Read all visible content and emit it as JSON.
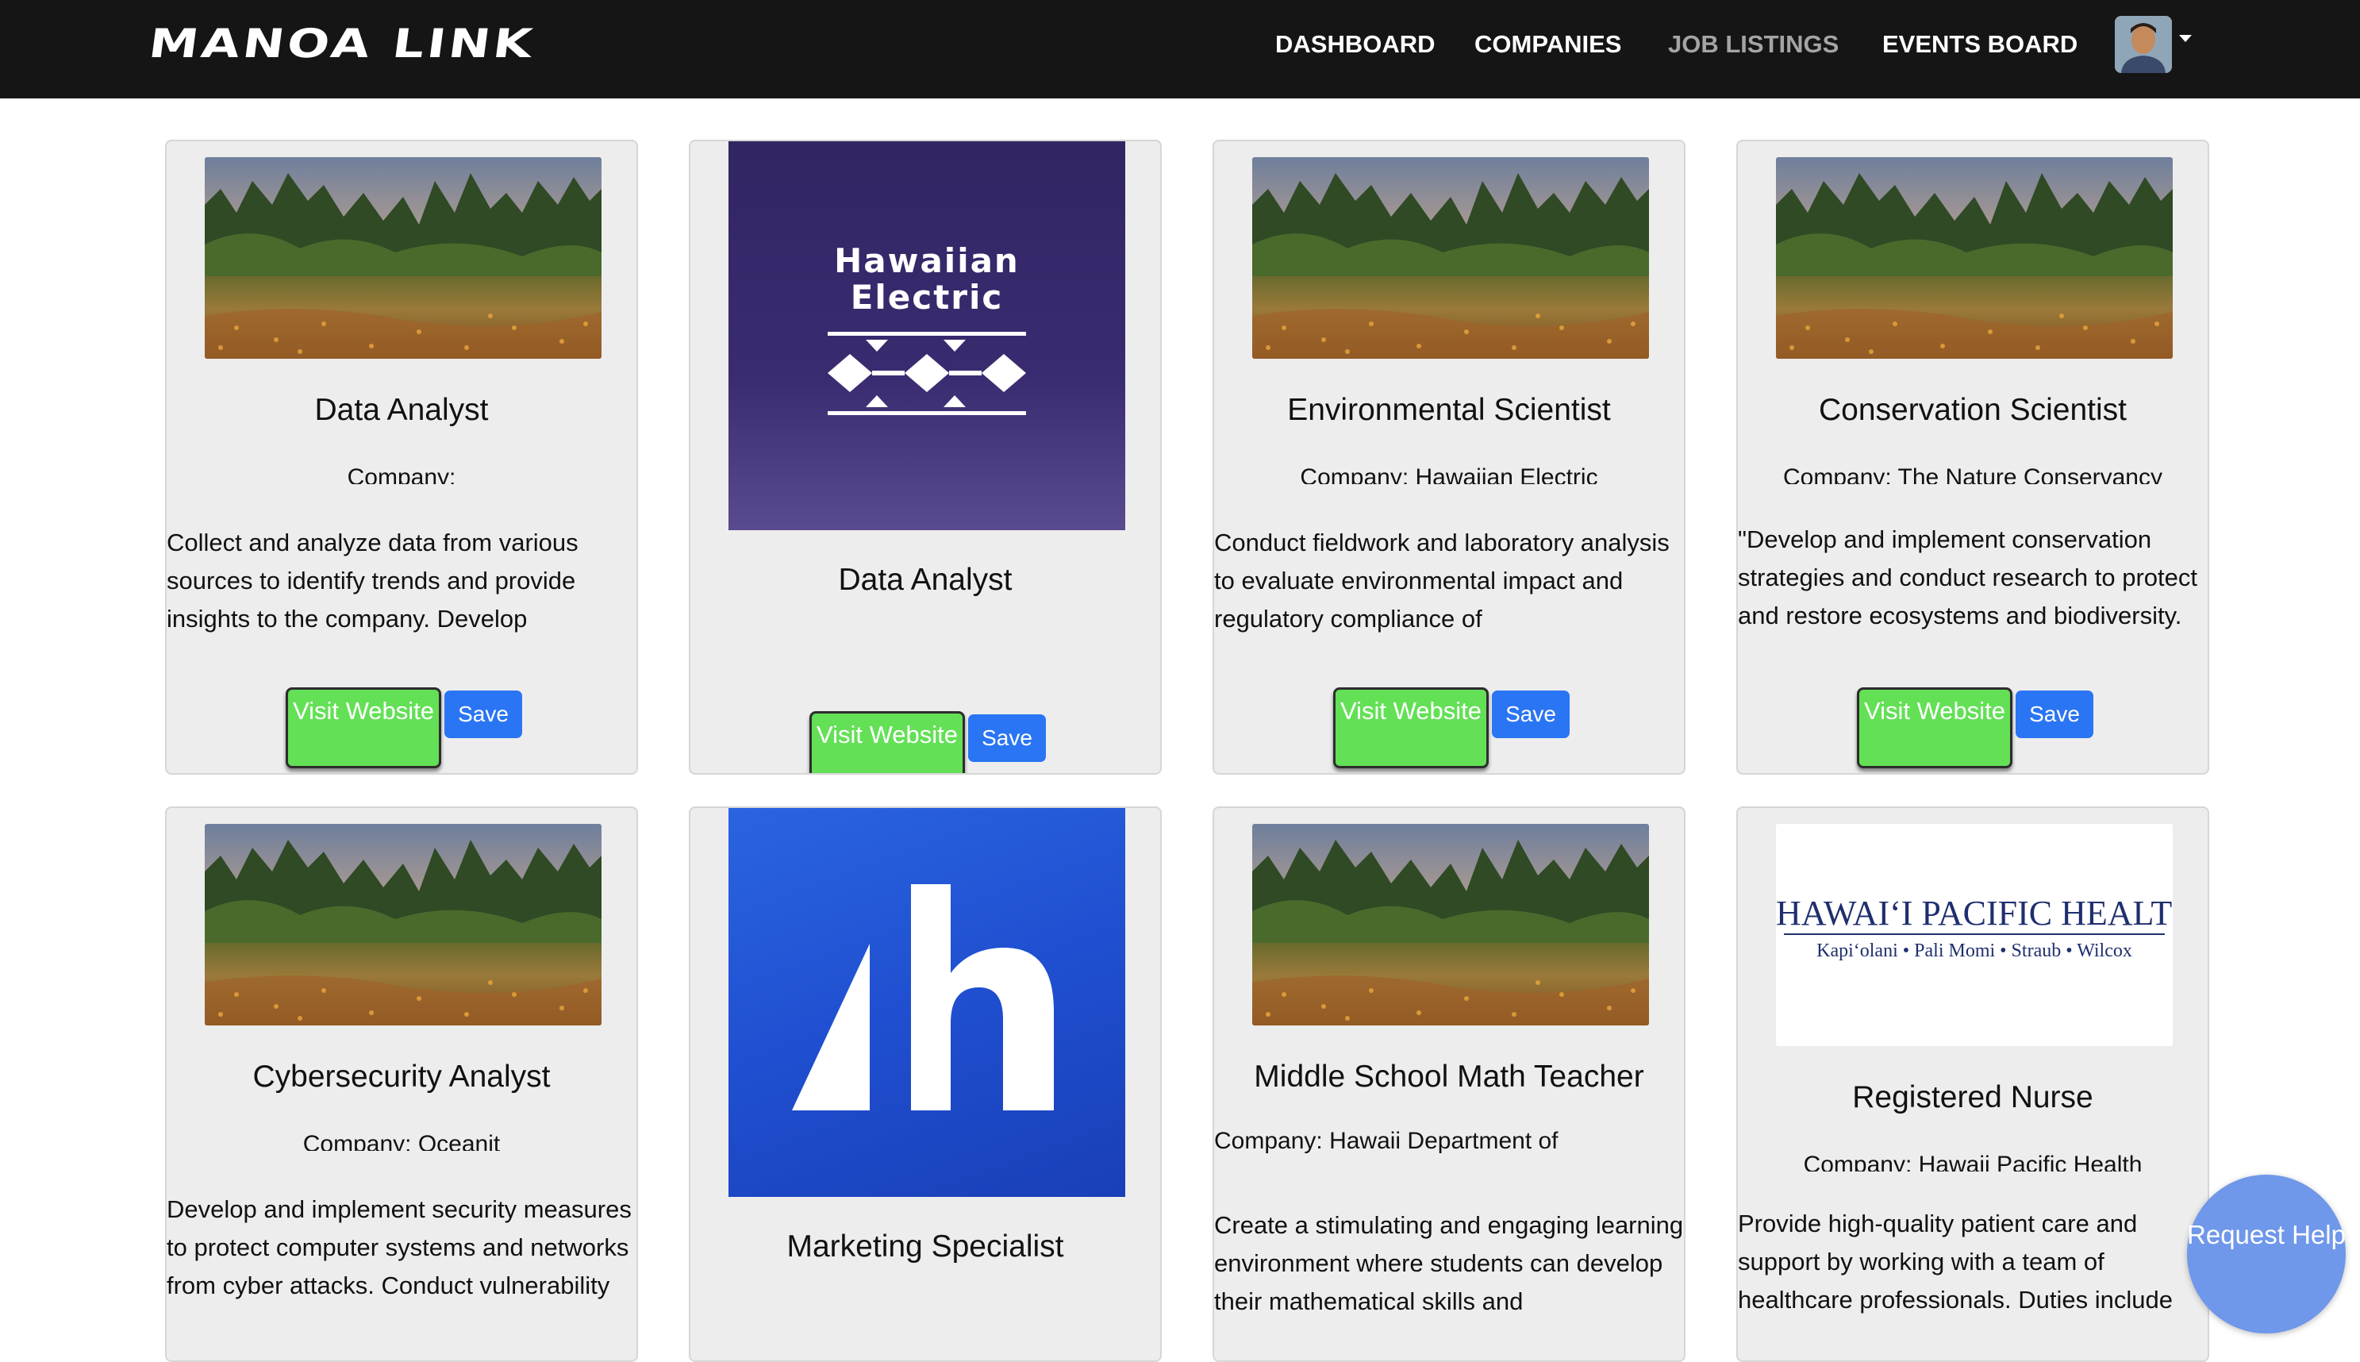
{
  "navbar": {
    "brand": "MANOA LINK",
    "links": [
      "DASHBOARD",
      "COMPANIES",
      "JOB LISTINGS",
      "EVENTS BOARD"
    ]
  },
  "cards": [
    {
      "title": "Data Analyst",
      "company": "Company:",
      "description": "Collect and analyze data from various sources to identify trends and provide insights to the company. Develop",
      "visit_label": "Visit Website",
      "save_label": "Save"
    },
    {
      "title": "Data Analyst",
      "logo_text": "Hawaiian Electric",
      "visit_label": "Visit Website",
      "save_label": "Save"
    },
    {
      "title": "Environmental Scientist",
      "company": "Company: Hawaiian Electric",
      "description": "Conduct fieldwork and laboratory analysis to evaluate environmental impact and regulatory compliance of",
      "visit_label": "Visit Website",
      "save_label": "Save"
    },
    {
      "title": "Conservation Scientist",
      "company": "Company: The Nature Conservancy",
      "description": "\"Develop and implement conservation strategies and conduct research to protect and restore ecosystems and biodiversity. Collaborate with",
      "visit_label": "Visit Website",
      "save_label": "Save"
    },
    {
      "title": "Cybersecurity Analyst",
      "company": "Company: Oceanit",
      "description": "Develop and implement security measures to protect computer systems and networks from cyber attacks. Conduct vulnerability assessments and"
    },
    {
      "title": "Marketing Specialist"
    },
    {
      "title": "Middle School Math Teacher",
      "company": "Company: Hawaii Department of",
      "description": "Create a stimulating and engaging learning environment where students can develop their mathematical skills and"
    },
    {
      "title": "Registered Nurse",
      "company": "Company: Hawaii Pacific Health",
      "logo_title": "HAWAIʻI PACIFIC HEALTH",
      "logo_subtitle": "Kapiʻolani • Pali Momi • Straub • Wilcox",
      "description": "Provide high-quality patient care and support by working with a team of healthcare professionals. Duties include"
    }
  ],
  "help_button": "Request Help",
  "colors": {
    "navbar": "#151515",
    "card_bg": "#ededed",
    "visit_button": "#63e056",
    "save_button": "#2a75f3",
    "help_button": "#6f97ea",
    "hawaiian_electric_bg": "#3f2c77",
    "logo_h_bg": "#1f4fd0",
    "hph_text": "#1f2f6e"
  },
  "icons": {
    "avatar": "user-avatar",
    "caret": "caret-down-icon"
  }
}
